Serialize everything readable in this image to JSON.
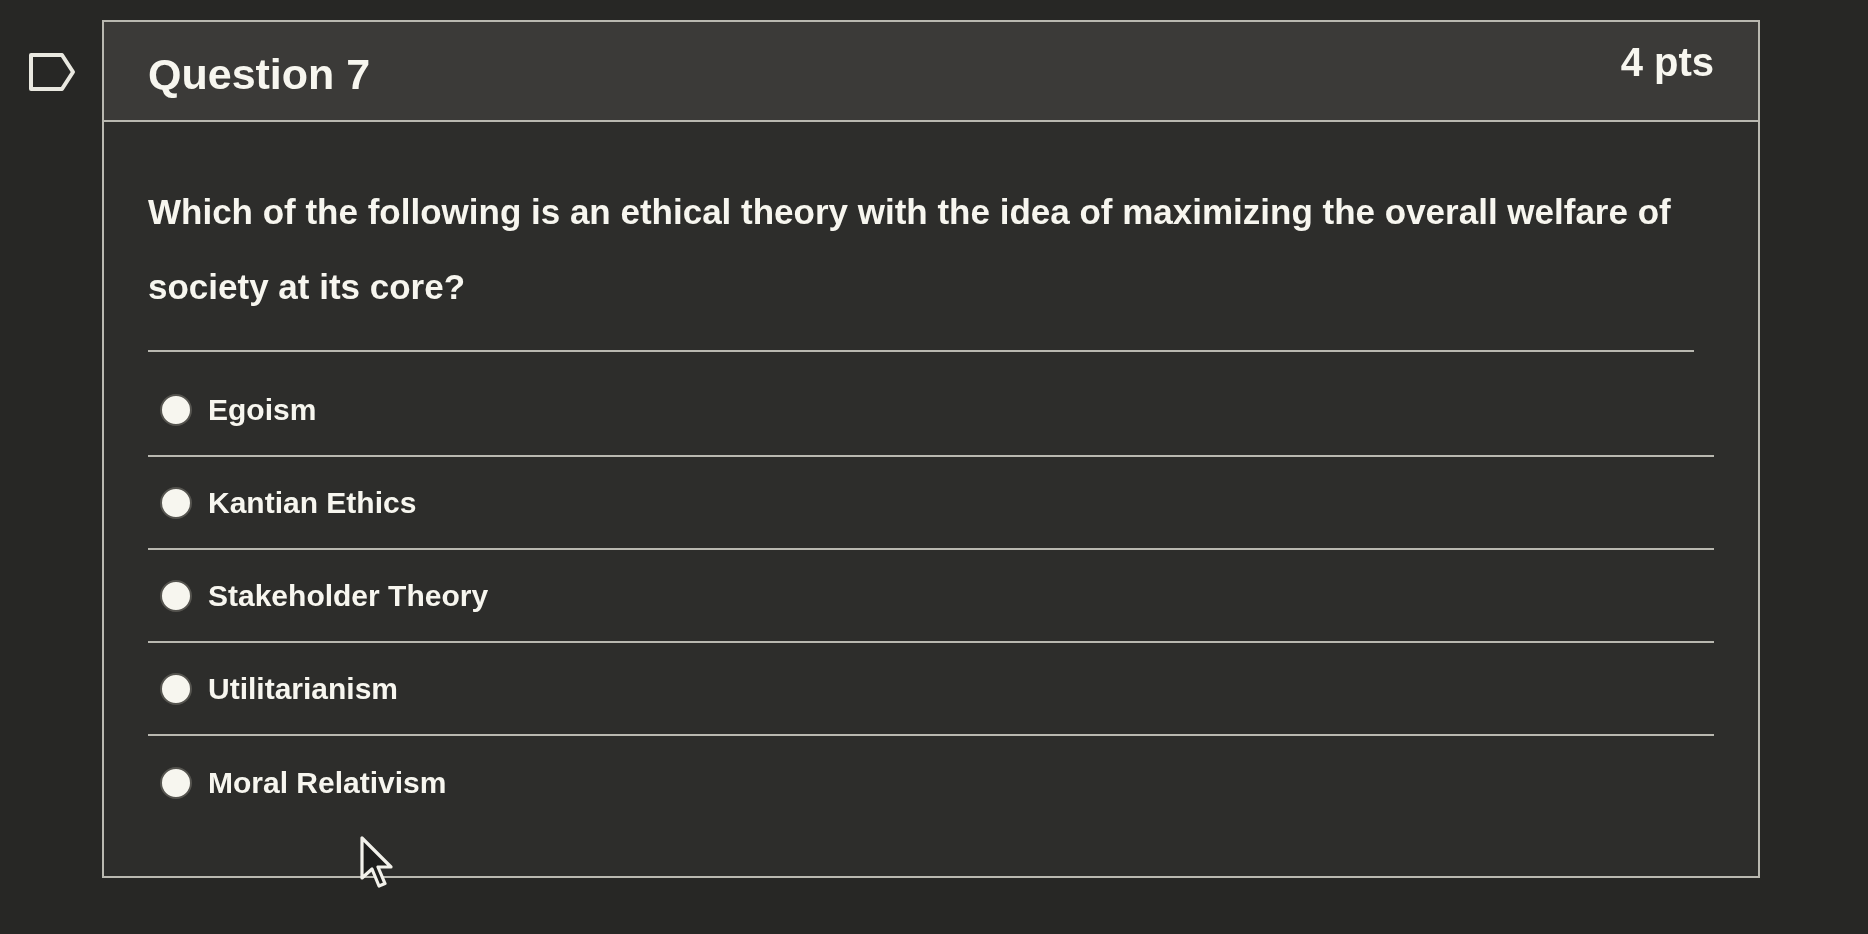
{
  "question": {
    "flagged": false,
    "title": "Question 7",
    "points": "4 pts",
    "text": "Which of the following is an ethical theory with the idea of maximizing the overall welfare of society at its core?",
    "answers": [
      {
        "label": "Egoism",
        "selected": false
      },
      {
        "label": "Kantian Ethics",
        "selected": false
      },
      {
        "label": "Stakeholder Theory",
        "selected": false
      },
      {
        "label": "Utilitarianism",
        "selected": false
      },
      {
        "label": "Moral Relativism",
        "selected": false
      }
    ]
  }
}
